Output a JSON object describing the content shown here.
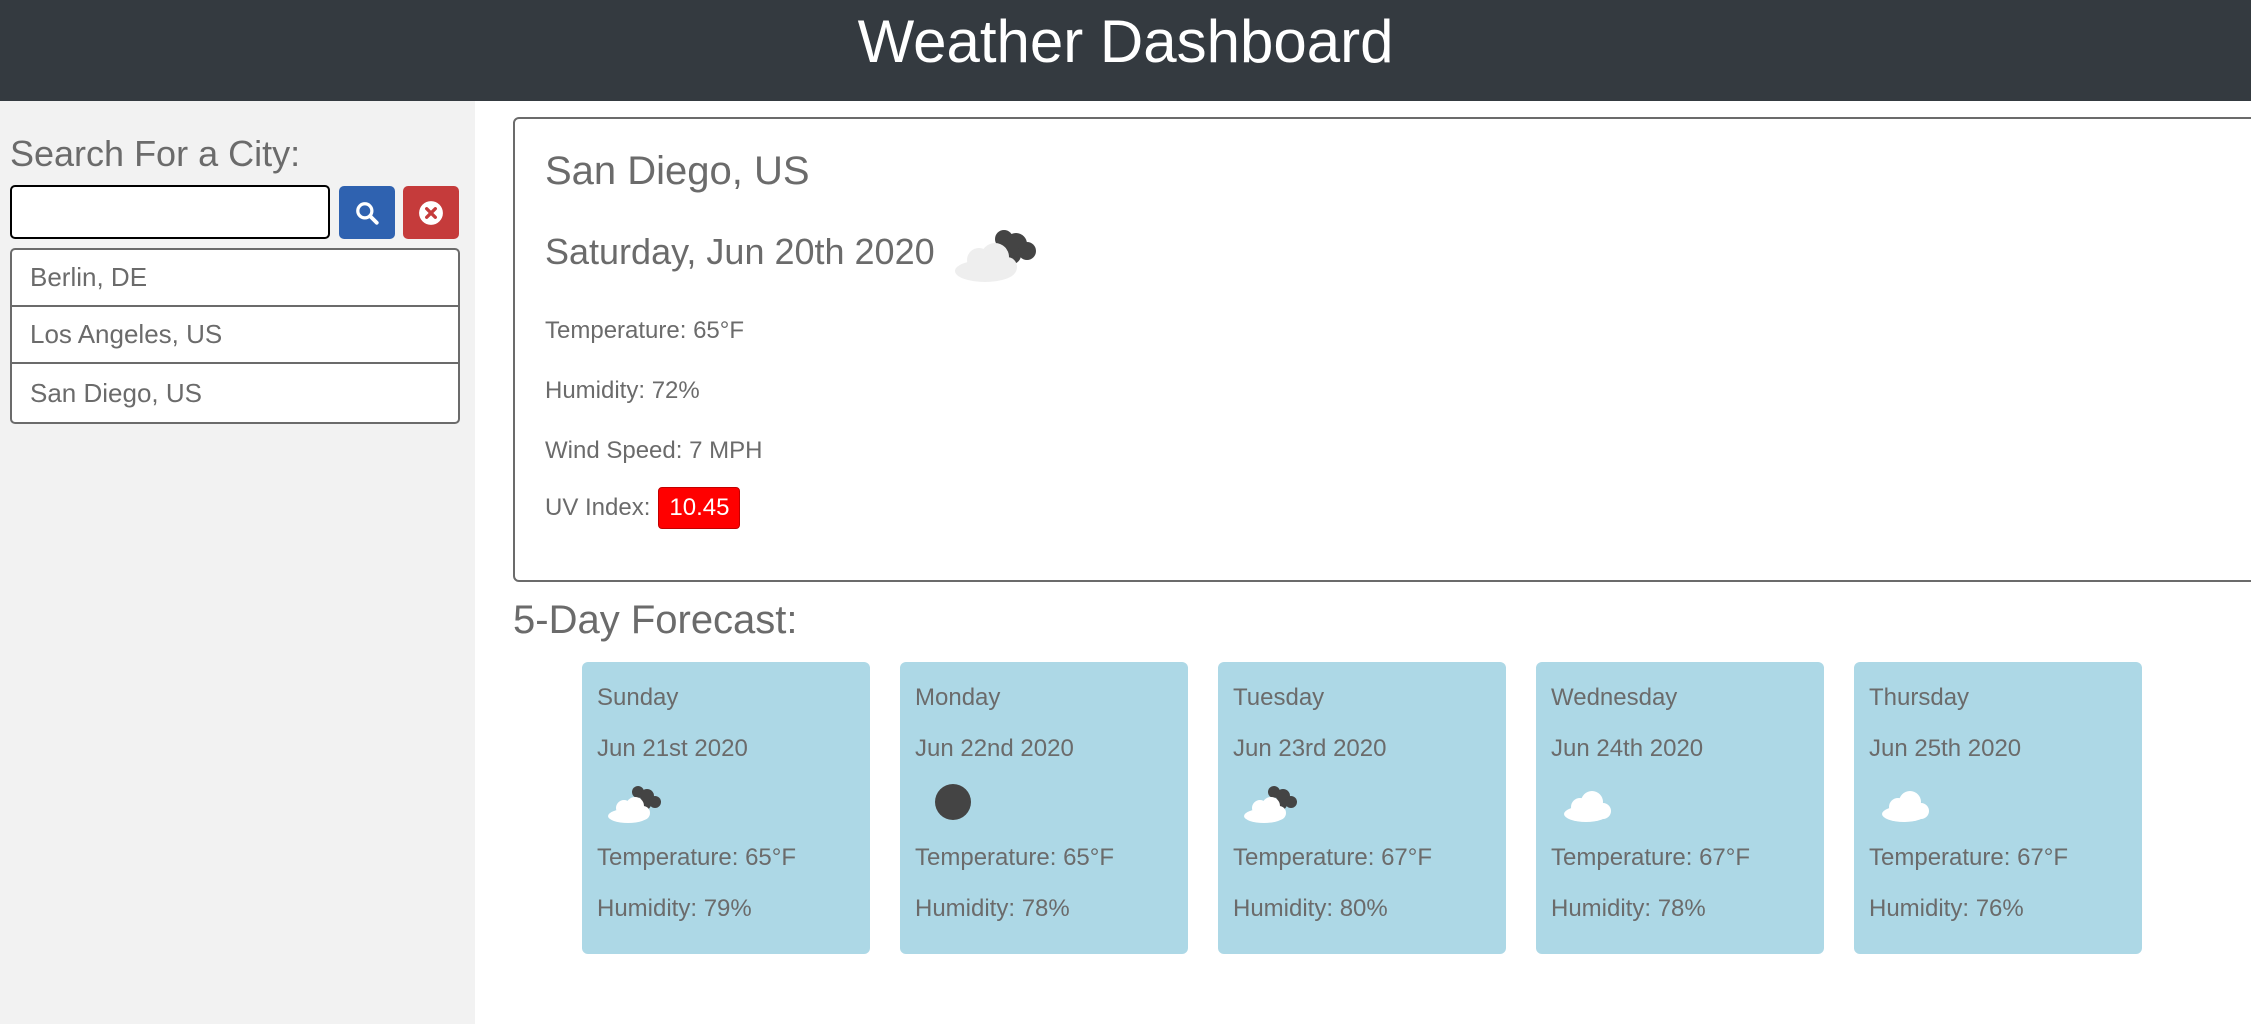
{
  "header": {
    "title": "Weather Dashboard"
  },
  "sidebar": {
    "title": "Search For a City:",
    "search": {
      "value": "",
      "placeholder": ""
    },
    "history": [
      {
        "label": "Berlin, DE"
      },
      {
        "label": "Los Angeles, US"
      },
      {
        "label": "San Diego, US"
      }
    ]
  },
  "current": {
    "city": "San Diego, US",
    "date": "Saturday, Jun 20th 2020",
    "icon": "partly-cloudy-night-icon",
    "temperature": "Temperature: 65°F",
    "humidity": "Humidity: 72%",
    "wind": "Wind Speed: 7 MPH",
    "uv_label": "UV Index:",
    "uv_value": "10.45",
    "uv_color": "#ff0000"
  },
  "forecast": {
    "title": "5-Day Forecast:",
    "days": [
      {
        "day": "Sunday",
        "date": "Jun 21st 2020",
        "icon": "partly-cloudy-night-icon",
        "temperature": "Temperature: 65°F",
        "humidity": "Humidity: 79%"
      },
      {
        "day": "Monday",
        "date": "Jun 22nd 2020",
        "icon": "clear-night-icon",
        "temperature": "Temperature: 65°F",
        "humidity": "Humidity: 78%"
      },
      {
        "day": "Tuesday",
        "date": "Jun 23rd 2020",
        "icon": "partly-cloudy-night-icon",
        "temperature": "Temperature: 67°F",
        "humidity": "Humidity: 80%"
      },
      {
        "day": "Wednesday",
        "date": "Jun 24th 2020",
        "icon": "cloud-icon",
        "temperature": "Temperature: 67°F",
        "humidity": "Humidity: 78%"
      },
      {
        "day": "Thursday",
        "date": "Jun 25th 2020",
        "icon": "cloud-icon",
        "temperature": "Temperature: 67°F",
        "humidity": "Humidity: 76%"
      }
    ]
  },
  "colors": {
    "header_bg": "#343a40",
    "search_button": "#2f62b0",
    "clear_button": "#c53b3b",
    "forecast_card": "#add8e6"
  }
}
